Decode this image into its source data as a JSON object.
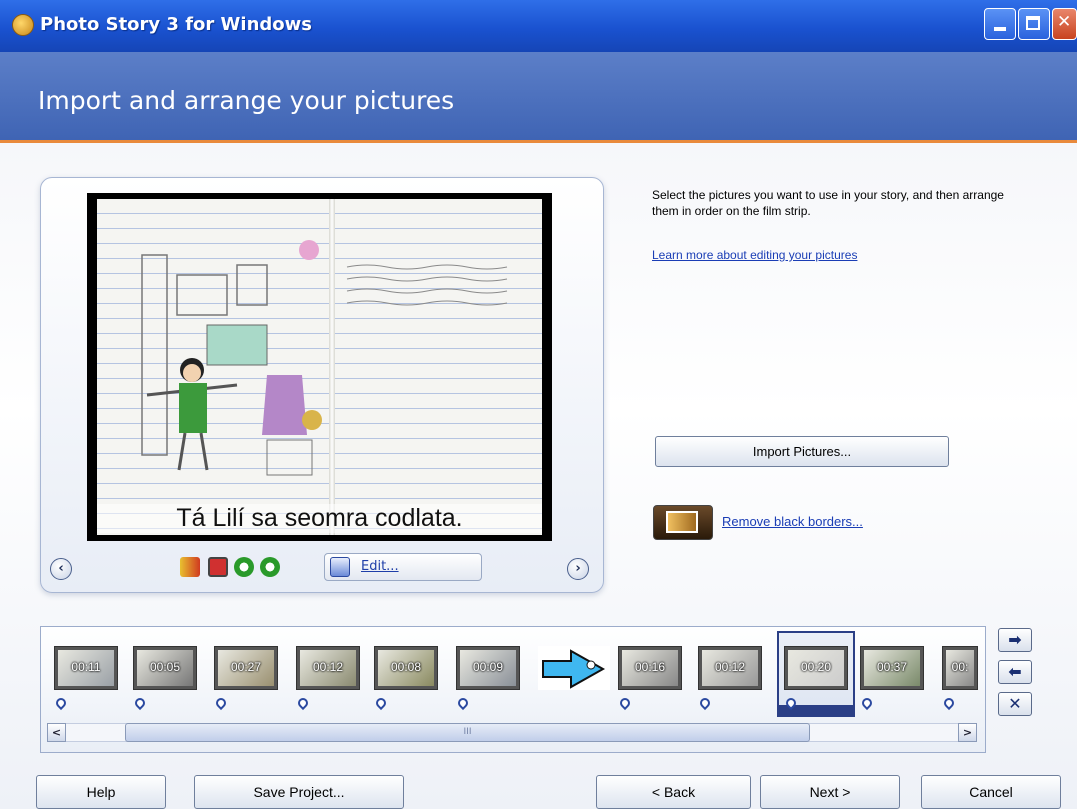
{
  "window": {
    "title": "Photo Story 3 for Windows"
  },
  "header": {
    "title": "Import and arrange your pictures"
  },
  "preview": {
    "caption": "Tá Lilí sa seomra codlata.",
    "edit_label": "Edit..."
  },
  "side": {
    "instructions": "Select the pictures you want to use in your story, and then arrange them in order on the film strip.",
    "learn_link": "Learn more about editing your pictures",
    "import_button": "Import Pictures...",
    "borders_link": "Remove black borders..."
  },
  "filmstrip": {
    "times": [
      "00:11",
      "00:05",
      "00:27",
      "00:12",
      "00:08",
      "00:09",
      "",
      "00:16",
      "00:12",
      "00:20",
      "00:37",
      "00:"
    ],
    "selected_index": 9,
    "scroll_grip": "III"
  },
  "buttons": {
    "help": "Help",
    "save": "Save Project...",
    "back": "< Back",
    "next": "Next >",
    "cancel": "Cancel"
  },
  "colors": {
    "titlebar": "#1a52d0",
    "header": "#4a6cbc",
    "accent_line": "#e98a3c",
    "link": "#1a3db5"
  },
  "icons": [
    "app-icon",
    "minimize-icon",
    "maximize-icon",
    "close-icon",
    "prev-picture-icon",
    "next-picture-icon",
    "auto-fix-icon",
    "red-eye-icon",
    "rotate-left-icon",
    "rotate-right-icon",
    "edit-icon",
    "remove-borders-icon",
    "move-right-icon",
    "move-left-icon",
    "delete-icon"
  ]
}
